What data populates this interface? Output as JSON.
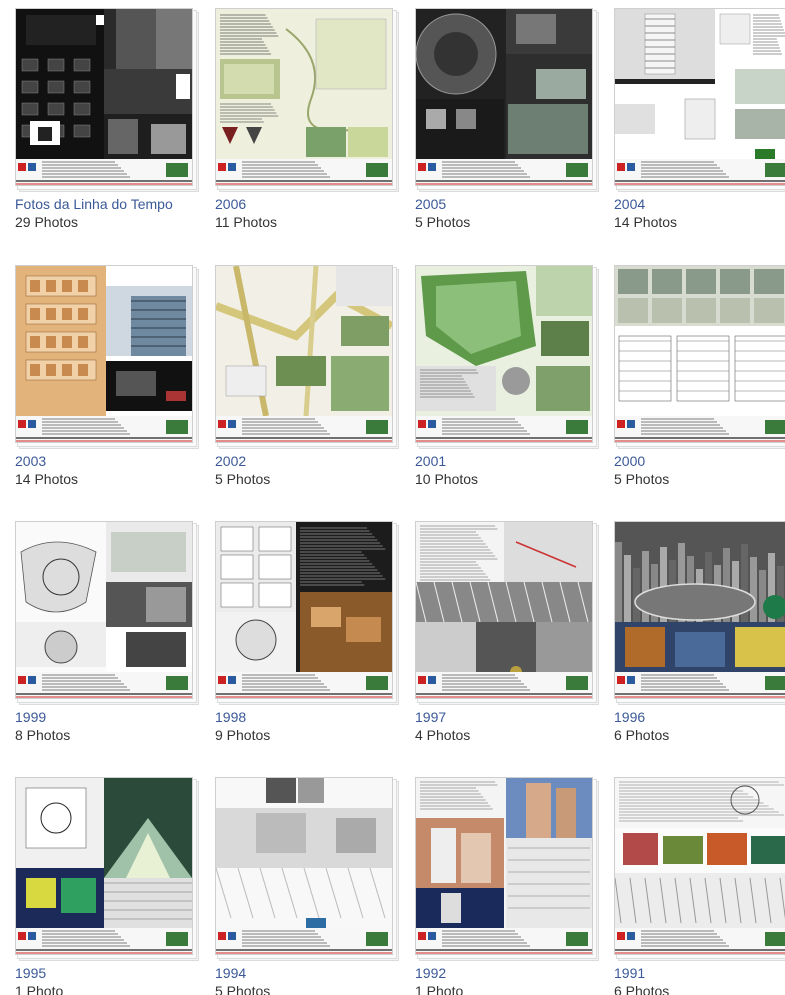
{
  "albums": [
    {
      "title": "Fotos da Linha do Tempo",
      "count": "29 Photos",
      "theme": "dark"
    },
    {
      "title": "2006",
      "count": "11 Photos",
      "theme": "green"
    },
    {
      "title": "2005",
      "count": "5 Photos",
      "theme": "darkgreen"
    },
    {
      "title": "2004",
      "count": "14 Photos",
      "theme": "white"
    },
    {
      "title": "2003",
      "count": "14 Photos",
      "theme": "orange"
    },
    {
      "title": "2002",
      "count": "5 Photos",
      "theme": "map"
    },
    {
      "title": "2001",
      "count": "10 Photos",
      "theme": "park"
    },
    {
      "title": "2000",
      "count": "5 Photos",
      "theme": "plans"
    },
    {
      "title": "1999",
      "count": "8 Photos",
      "theme": "gray"
    },
    {
      "title": "1998",
      "count": "9 Photos",
      "theme": "brown"
    },
    {
      "title": "1997",
      "count": "4 Photos",
      "theme": "bw"
    },
    {
      "title": "1996",
      "count": "6 Photos",
      "theme": "city"
    },
    {
      "title": "1995",
      "count": "1 Photo",
      "theme": "tunnel"
    },
    {
      "title": "1994",
      "count": "5 Photos",
      "theme": "light"
    },
    {
      "title": "1992",
      "count": "1 Photo",
      "theme": "towers"
    },
    {
      "title": "1991",
      "count": "6 Photos",
      "theme": "street"
    }
  ],
  "colors": {
    "link": "#3b5998",
    "count": "#333333",
    "accent_red": "#cc2222"
  }
}
